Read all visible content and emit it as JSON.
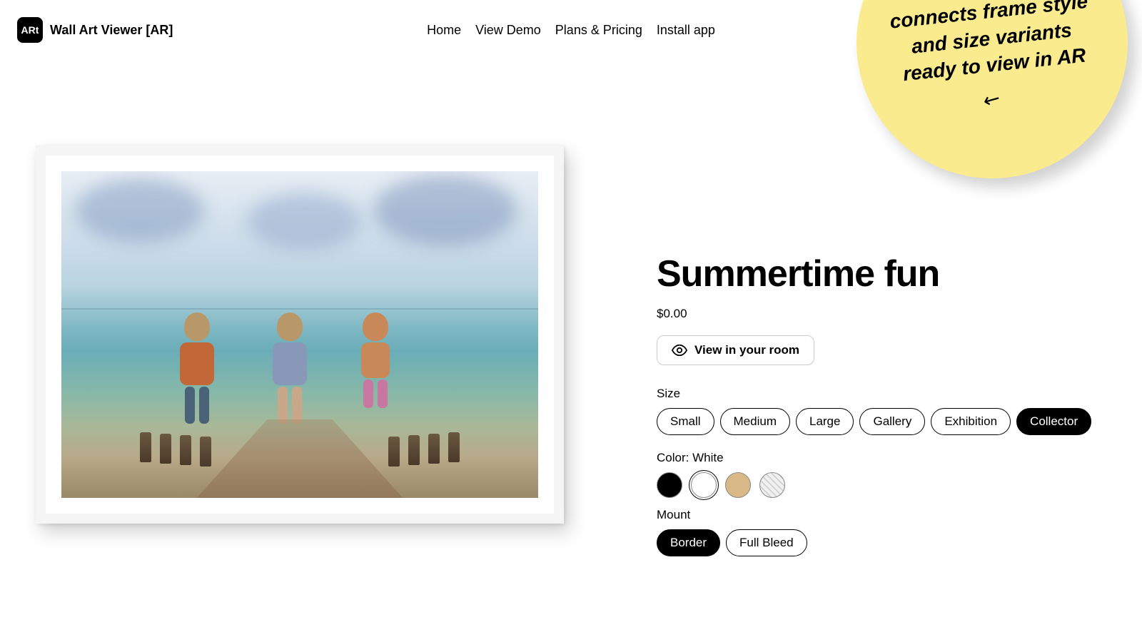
{
  "logo": {
    "icon_text": "ARt",
    "text": "Wall Art Viewer [AR]"
  },
  "nav": {
    "home": "Home",
    "demo": "View Demo",
    "pricing": "Plans & Pricing",
    "install": "Install app"
  },
  "badge": {
    "text": "Wall Art Viewer connects frame style and size variants ready to view in AR",
    "arrow": "↙"
  },
  "product": {
    "title": "Summertime fun",
    "price": "$0.00",
    "view_room_label": "View in your room"
  },
  "options": {
    "size_label": "Size",
    "sizes": {
      "small": "Small",
      "medium": "Medium",
      "large": "Large",
      "gallery": "Gallery",
      "exhibition": "Exhibition",
      "collector": "Collector"
    },
    "size_selected": "Collector",
    "color_label": "Color: White",
    "color_selected": "White",
    "colors": [
      "Black",
      "White",
      "Tan",
      "Patterned"
    ],
    "mount_label": "Mount",
    "mounts": {
      "border": "Border",
      "full_bleed": "Full Bleed"
    },
    "mount_selected": "Border"
  }
}
